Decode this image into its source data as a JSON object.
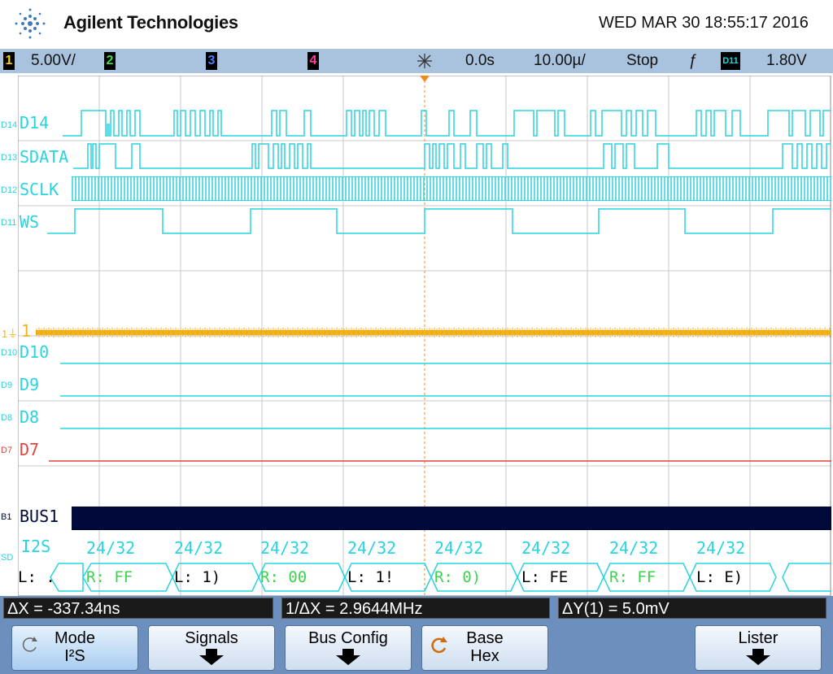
{
  "header": {
    "brand": "Agilent Technologies",
    "datetime": "WED MAR 30 18:55:17 2016"
  },
  "status": {
    "ch1_num": "1",
    "ch1_scale": "5.00V/",
    "ch2_num": "2",
    "ch3_num": "3",
    "ch4_num": "4",
    "delay": "0.0s",
    "timebase": "10.00µ/",
    "run_state": "Stop",
    "trigger_slope": "ƒ",
    "trigger_source": "D11",
    "trigger_level": "1.80V"
  },
  "colors": {
    "digital": "#29d3e0",
    "analog1": "#f2b21b",
    "d7": "#e0443e",
    "bus": "#000a3a",
    "decode": "#55e86b"
  },
  "traces": {
    "d14": "D14",
    "d13": "SDATA",
    "d12": "SCLK",
    "d11": "WS",
    "ch1": "1",
    "d10": "D10",
    "d9": "D9",
    "d8": "D8",
    "d7": "D7",
    "bus": "BUS1",
    "protocol": "I2S"
  },
  "tags": {
    "d14": "D14",
    "d13": "D13",
    "d12": "D12",
    "d11": "D11",
    "d10": "D10",
    "d9": "D9",
    "d8": "D8",
    "d7": "D7",
    "b1": "B1",
    "sd": "SD"
  },
  "decode": {
    "sizes": [
      "24/32",
      "24/32",
      "24/32",
      "24/32",
      "24/32",
      "24/32",
      "24/32",
      "24/32"
    ],
    "packets": [
      "L: .",
      "R: FF",
      "L: 1)",
      "R: 00",
      "L: 1!",
      "R: 0)",
      "L: FE",
      "R: FF",
      "L: E)"
    ]
  },
  "readouts": {
    "delta_x": "ΔX = -337.34ns",
    "inv_delta_x": "1/ΔX = 2.9644MHz",
    "delta_y": "ΔY(1) = 5.0mV"
  },
  "softkeys": [
    {
      "line1": "Mode",
      "line2": "I²S"
    },
    {
      "line1": "Signals",
      "line2": ""
    },
    {
      "line1": "Bus Config",
      "line2": ""
    },
    {
      "line1": "Base",
      "line2": "Hex"
    },
    {
      "line1": "Lister",
      "line2": ""
    }
  ]
}
